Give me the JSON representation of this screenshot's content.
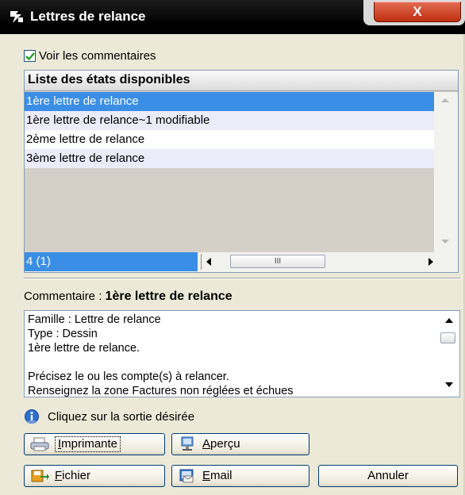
{
  "window": {
    "title": "Lettres de relance",
    "close_label": "X"
  },
  "options": {
    "show_comments_label": "Voir les commentaires",
    "show_comments_checked": true
  },
  "list": {
    "header": "Liste des états disponibles",
    "items": [
      "1ère lettre de relance",
      "1ère lettre de relance~1 modifiable",
      "2ème lettre de relance",
      "3ème lettre de relance"
    ],
    "selected_index": 0,
    "count": "4 (1)",
    "hscroll_thumb": "III"
  },
  "comment": {
    "label": "Commentaire :",
    "title": "1ère lettre de relance",
    "lines": [
      "Famille : Lettre de relance",
      "Type : Dessin",
      "1ère lettre de relance.",
      "",
      "Précisez le ou les compte(s) à relancer.",
      "Renseignez la zone Factures non réglées et échues"
    ]
  },
  "hint": "Cliquez sur la sortie désirée",
  "buttons": {
    "print": {
      "pre": "",
      "accel": "I",
      "post": "mprimante"
    },
    "preview": {
      "pre": "",
      "accel": "A",
      "post": "perçu"
    },
    "file": {
      "pre": "",
      "accel": "F",
      "post": "ichier"
    },
    "email": {
      "pre": "",
      "accel": "E",
      "post": "mail"
    },
    "cancel": "Annuler"
  },
  "colors": {
    "selection": "#3a8ee6",
    "title_bar": "#000000",
    "close_button": "#c8402a"
  }
}
